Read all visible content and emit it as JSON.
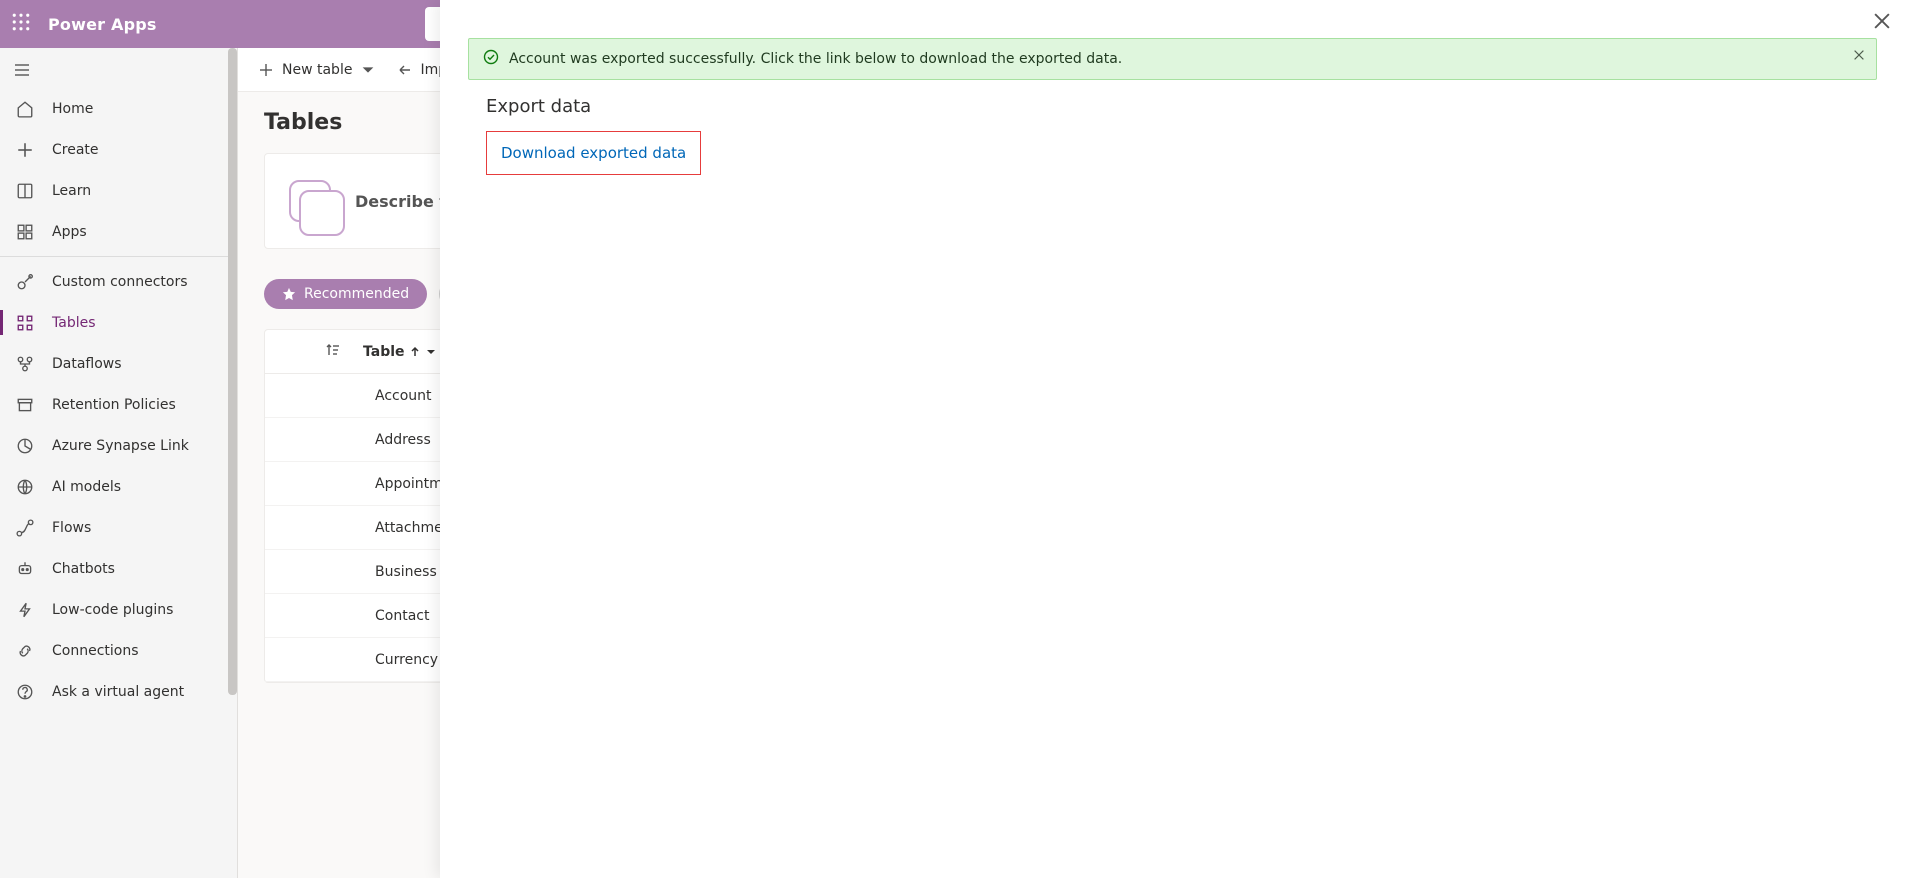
{
  "header": {
    "app_name": "Power Apps"
  },
  "nav": {
    "items": [
      {
        "label": "Home"
      },
      {
        "label": "Create"
      },
      {
        "label": "Learn"
      },
      {
        "label": "Apps"
      },
      {
        "label": "Custom connectors"
      },
      {
        "label": "Tables"
      },
      {
        "label": "Dataflows"
      },
      {
        "label": "Retention Policies"
      },
      {
        "label": "Azure Synapse Link"
      },
      {
        "label": "AI models"
      },
      {
        "label": "Flows"
      },
      {
        "label": "Chatbots"
      },
      {
        "label": "Low-code plugins"
      },
      {
        "label": "Connections"
      },
      {
        "label": "Ask a virtual agent"
      }
    ]
  },
  "command_bar": {
    "new_table": "New table",
    "import": "Import"
  },
  "page": {
    "title": "Tables",
    "hero_text": "Describe the",
    "recommended_pill": "Recommended"
  },
  "table": {
    "header": "Table",
    "rows": [
      "Account",
      "Address",
      "Appointment",
      "Attachment",
      "Business Unit",
      "Contact",
      "Currency"
    ]
  },
  "panel": {
    "alert_text": "Account was exported successfully. Click the link below to download the exported data.",
    "title": "Export data",
    "download_link": "Download exported data"
  }
}
